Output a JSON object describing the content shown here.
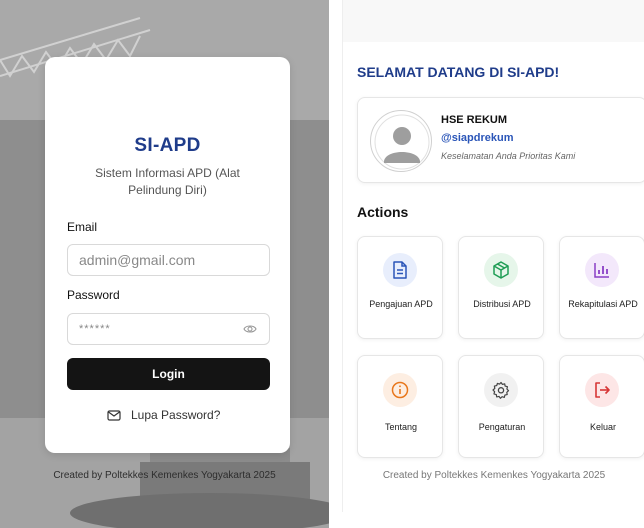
{
  "login": {
    "title": "SI-APD",
    "subtitle": "Sistem Informasi APD (Alat Pelindung Diri)",
    "email_label": "Email",
    "email_value": "admin@gmail.com",
    "password_label": "Password",
    "password_value": "******",
    "login_button": "Login",
    "forgot_password": "Lupa Password?",
    "footer": "Created by Poltekkes Kemenkes Yogyakarta 2025"
  },
  "dashboard": {
    "welcome": "SELAMAT DATANG DI SI-APD!",
    "profile": {
      "name": "HSE REKUM",
      "handle": "@siapdrekum",
      "tagline": "Keselamatan Anda Prioritas Kami"
    },
    "actions_heading": "Actions",
    "actions": [
      {
        "label": "Pengajuan APD",
        "icon": "document-icon",
        "color": "#2a55b8"
      },
      {
        "label": "Distribusi APD",
        "icon": "package-icon",
        "color": "#1f9d55"
      },
      {
        "label": "Rekapitulasi APD",
        "icon": "bar-chart-icon",
        "color": "#8a3fc6"
      },
      {
        "label": "Tentang",
        "icon": "info-icon",
        "color": "#e8771c"
      },
      {
        "label": "Pengaturan",
        "icon": "gear-icon",
        "color": "#444444"
      },
      {
        "label": "Keluar",
        "icon": "logout-icon",
        "color": "#d63636"
      }
    ],
    "footer": "Created by Poltekkes Kemenkes Yogyakarta 2025"
  },
  "colors": {
    "brand_blue": "#1f3c8a",
    "button_dark": "#141414"
  }
}
